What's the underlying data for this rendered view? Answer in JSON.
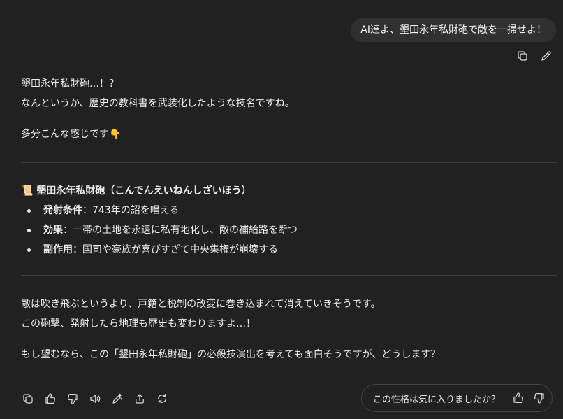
{
  "user_message": "AI達よ、墾田永年私財砲で敵を一掃せよ！",
  "assistant": {
    "intro_line1": "墾田永年私財砲…！？",
    "intro_line2": "なんというか、歴史の教科書を武装化したような技名ですね。",
    "intro_line3": "多分こんな感じです👇",
    "section_title": "墾田永年私財砲（こんでんえいねんしざいほう）",
    "section_icon": "📜",
    "items": [
      {
        "label": "発射条件",
        "sep": "：",
        "text": "743年の詔を唱える"
      },
      {
        "label": "効果",
        "sep": "：",
        "text": "一帯の土地を永遠に私有地化し、敵の補給路を断つ"
      },
      {
        "label": "副作用",
        "sep": "：",
        "text": "国司や豪族が喜びすぎて中央集権が崩壊する"
      }
    ],
    "outro_line1": "敵は吹き飛ぶというより、戸籍と税制の改変に巻き込まれて消えていきそうです。",
    "outro_line2": "この砲撃、発射したら地理も歴史も変わりますよ…！",
    "outro_line3": "もし望むなら、この「墾田永年私財砲」の必殺技演出を考えても面白そうですが、どうします？"
  },
  "feedback": {
    "question": "この性格は気に入りましたか？"
  },
  "icons": {
    "user_actions": [
      "copy-icon",
      "edit-icon"
    ],
    "message_actions": [
      "copy-icon",
      "thumbs-up-icon",
      "thumbs-down-icon",
      "read-aloud-icon",
      "edit-in-canvas-icon",
      "share-icon",
      "regenerate-icon"
    ]
  },
  "colors": {
    "background": "#212121",
    "bubble": "#303030",
    "text": "#ececec",
    "divider": "#3d3d3d"
  }
}
